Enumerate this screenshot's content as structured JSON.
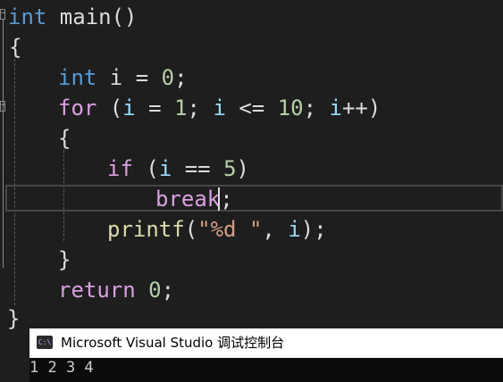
{
  "editor": {
    "lines": [
      {
        "t1": "int",
        "t2": " main()"
      },
      {
        "t1": "{"
      },
      {
        "t1": "int",
        "t2": " i = ",
        "t3": "0",
        "t4": ";"
      },
      {
        "t1": "for",
        "t2": " (",
        "t3": "i",
        "t4": " = ",
        "t5": "1",
        "t6": "; ",
        "t7": "i",
        "t8": " <= ",
        "t9": "10",
        "t10": "; ",
        "t11": "i",
        "t12": "++)"
      },
      {
        "t1": "{"
      },
      {
        "t1": "if",
        "t2": " (",
        "t3": "i",
        "t4": " == ",
        "t5": "5",
        "t6": ")"
      },
      {
        "t1": "break",
        "t2": ";"
      },
      {
        "t1": "printf",
        "t2": "(",
        "t3": "\"%d \"",
        "t4": ", ",
        "t5": "i",
        "t6": ");"
      },
      {
        "t1": "}"
      },
      {
        "t1": "return",
        "t2": " ",
        "t3": "0",
        "t4": ";"
      },
      {
        "t1": "}"
      }
    ],
    "fold_markers": [
      "−",
      "−"
    ]
  },
  "console": {
    "title": "Microsoft Visual Studio 调试控制台",
    "icon_label": "C:\\",
    "output_line1": "1 2 3 4"
  },
  "colors": {
    "background": "#1e1e1e",
    "keyword": "#569cd6",
    "control": "#d8a0df",
    "function": "#dcdcaa",
    "variable": "#9cdcfe",
    "number": "#b5cea8",
    "string": "#d69d85"
  }
}
